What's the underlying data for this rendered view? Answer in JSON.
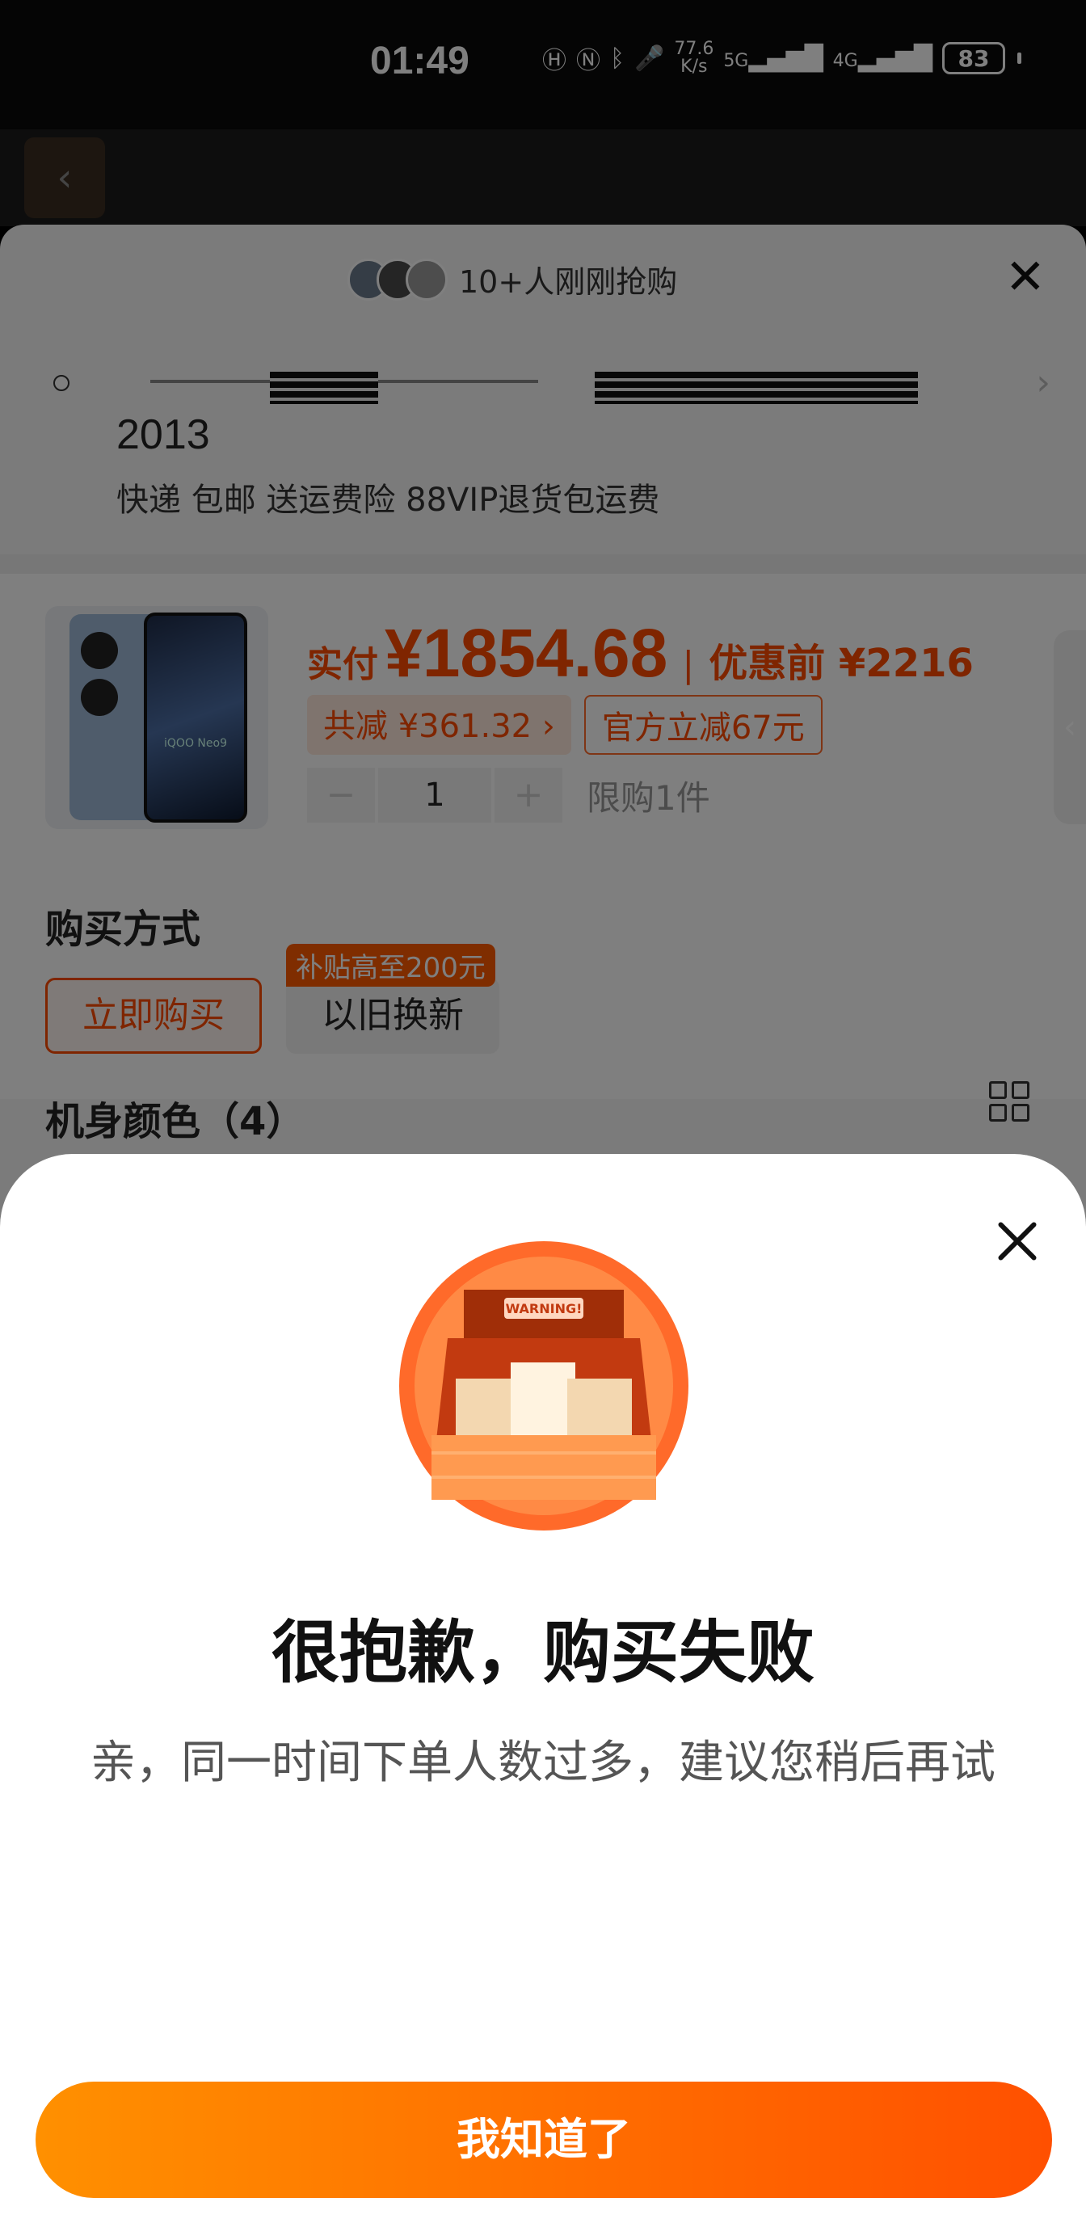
{
  "status_bar": {
    "time": "01:49",
    "net_speed_value": "77.6",
    "net_speed_unit": "K/s",
    "signal_1": "5G",
    "signal_2": "4G",
    "battery": "83"
  },
  "sheet": {
    "buyers_text": "10+人刚刚抢购",
    "address_year": "2013",
    "shipping_text": "快递 包邮 送运费险 88VIP退货包运费",
    "price_label": "实付",
    "price_value": "¥1854.68",
    "price_separator": "|",
    "original_price": "优惠前 ¥2216",
    "discount_total": "共减 ¥361.32 ›",
    "discount_official": "官方立减67元",
    "quantity": "1",
    "qty_minus": "−",
    "qty_plus": "+",
    "qty_limit": "限购1件",
    "buy_method_title": "购买方式",
    "buy_now": "立即购买",
    "trade_in": "以旧换新",
    "subsidy_badge": "补贴高至200元",
    "color_title": "机身颜色（4）",
    "product_logo": "iQOO Neo9"
  },
  "modal": {
    "title": "很抱歉，购买失败",
    "description": "亲，同一时间下单人数过多，建议您稍后再试",
    "confirm_label": "我知道了",
    "illustration_text": "WARNING!"
  },
  "colors": {
    "accent": "#ff4a00",
    "button_gradient_start": "#ff9000",
    "button_gradient_end": "#ff5000"
  }
}
